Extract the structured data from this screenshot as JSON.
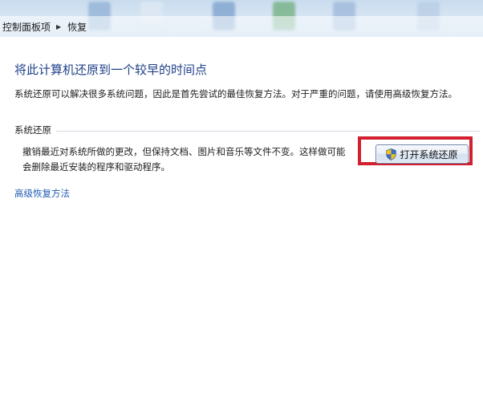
{
  "breadcrumb": {
    "items": [
      "控制面板项",
      "恢复"
    ]
  },
  "page": {
    "title": "将此计算机还原到一个较早的时间点",
    "intro": "系统还原可以解决很多系统问题，因此是首先尝试的最佳恢复方法。对于严重的问题，请使用高级恢复方法。"
  },
  "system_restore": {
    "section_label": "系统还原",
    "description_line1": "撤销最近对系统所做的更改，但保持文档、图片和音乐等文件不变。这样做可能",
    "description_line2": "会删除最近安装的程序和驱动程序。",
    "open_button_label": "打开系统还原"
  },
  "links": {
    "advanced_recovery": "高级恢复方法"
  },
  "colors": {
    "title": "#1e3f87",
    "link": "#1f5cb3",
    "highlight": "#d2202f"
  },
  "icons": [
    "chevron-right-icon",
    "uac-shield-icon"
  ]
}
